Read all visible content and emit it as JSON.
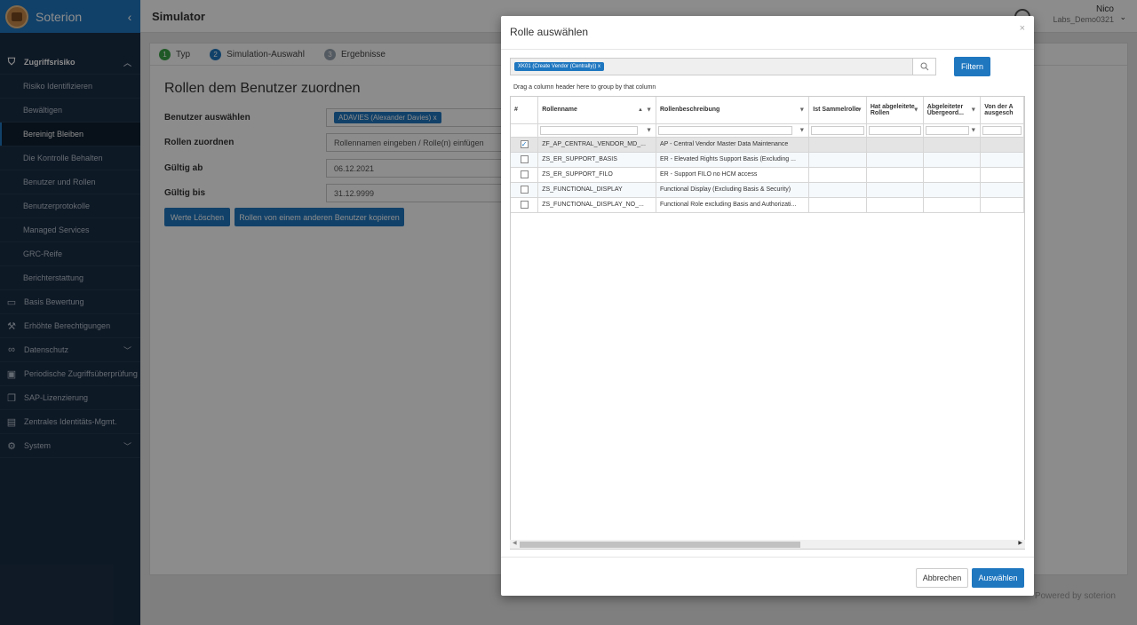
{
  "brand": {
    "name": "Soterion"
  },
  "sidebar": {
    "collapse_icon": "chevron-left-icon",
    "items": [
      {
        "label": "Zugriffsrisiko",
        "type": "group",
        "icon": "shield-icon",
        "expanded": true
      },
      {
        "label": "Risiko Identifizieren",
        "type": "sub"
      },
      {
        "label": "Bewältigen",
        "type": "sub"
      },
      {
        "label": "Bereinigt Bleiben",
        "type": "sub",
        "active": true
      },
      {
        "label": "Die Kontrolle Behalten",
        "type": "sub"
      },
      {
        "label": "Benutzer und Rollen",
        "type": "sub"
      },
      {
        "label": "Benutzerprotokolle",
        "type": "sub"
      },
      {
        "label": "Managed Services",
        "type": "sub"
      },
      {
        "label": "GRC-Reife",
        "type": "sub"
      },
      {
        "label": "Berichterstattung",
        "type": "sub"
      },
      {
        "label": "Basis Bewertung",
        "type": "item",
        "icon": "clipboard-icon"
      },
      {
        "label": "Erhöhte Berechtigungen",
        "type": "item",
        "icon": "hammer-icon"
      },
      {
        "label": "Datenschutz",
        "type": "item",
        "icon": "glasses-icon",
        "has_chevron": true
      },
      {
        "label": "Periodische Zugriffsüberprüfung",
        "type": "item",
        "icon": "calendar-check-icon"
      },
      {
        "label": "SAP-Lizenzierung",
        "type": "item",
        "icon": "copy-icon"
      },
      {
        "label": "Zentrales Identitäts-Mgmt.",
        "type": "item",
        "icon": "id-card-icon"
      },
      {
        "label": "System",
        "type": "item",
        "icon": "gears-icon",
        "has_chevron": true
      }
    ]
  },
  "header": {
    "title": "Simulator",
    "user_name": "Nico",
    "user_tenant": "Labs_Demo0321"
  },
  "steps": [
    {
      "num": "1",
      "label": "Typ",
      "color": "#3aa345"
    },
    {
      "num": "2",
      "label": "Simulation-Auswahl",
      "color": "#1f77c0"
    },
    {
      "num": "3",
      "label": "Ergebnisse",
      "color": "#9aa5b1"
    }
  ],
  "form": {
    "section_title": "Rollen dem Benutzer zuordnen",
    "user_label": "Benutzer auswählen",
    "user_chip": "ADAVIES (Alexander Davies)",
    "chip_remove": "x",
    "roles_label": "Rollen zuordnen",
    "roles_placeholder": "Rollennamen eingeben / Rolle(n) einfügen",
    "valid_from_label": "Gültig ab",
    "valid_from_value": "06.12.2021",
    "valid_to_label": "Gültig bis",
    "valid_to_value": "31.12.9999",
    "clear_button": "Werte Löschen",
    "copy_button": "Rollen von einem anderen Benutzer kopieren"
  },
  "powered_by": "Powered by soterion",
  "modal": {
    "title": "Rolle auswählen",
    "close": "×",
    "search_chip": "XK01 (Create Vendor (Centrally))",
    "chip_remove": "x",
    "filter_button": "Filtern",
    "group_hint": "Drag a column header here to group by that column",
    "columns": [
      "#",
      "Rollenname",
      "Rollenbeschreibung",
      "Ist Sammelrolle",
      "Hat abgeleitete Rollen",
      "Abgeleiteter Übergeord...",
      "Von der A ausgesch"
    ],
    "rows": [
      {
        "checked": true,
        "name": "ZF_AP_CENTRAL_VENDOR_MD_...",
        "desc": "AP - Central Vendor Master Data Maintenance"
      },
      {
        "checked": false,
        "name": "ZS_ER_SUPPORT_BASIS",
        "desc": "ER - Elevated Rights Support Basis (Excluding ..."
      },
      {
        "checked": false,
        "name": "ZS_ER_SUPPORT_FILO",
        "desc": "ER - Support FILO no HCM access"
      },
      {
        "checked": false,
        "name": "ZS_FUNCTIONAL_DISPLAY",
        "desc": "Functional Display (Excluding Basis & Security)"
      },
      {
        "checked": false,
        "name": "ZS_FUNCTIONAL_DISPLAY_NO_...",
        "desc": "Functional Role excluding Basis and Authorizati..."
      }
    ],
    "cancel_button": "Abbrechen",
    "select_button": "Auswählen",
    "checkmark": "✓"
  },
  "colors": {
    "primary": "#1f77c0",
    "sidebar": "#1b2f45"
  }
}
